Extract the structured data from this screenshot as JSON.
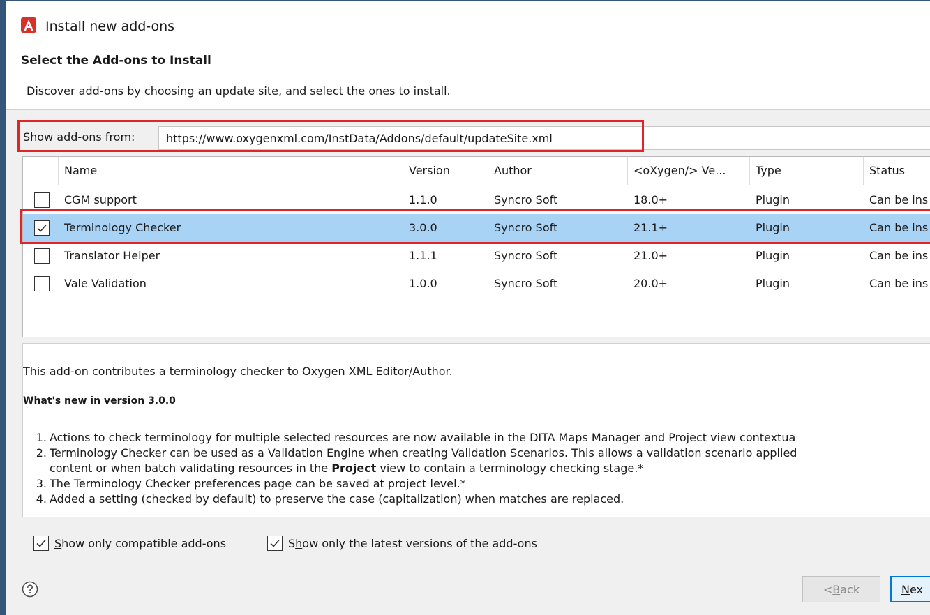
{
  "window": {
    "title": "Install new add-ons"
  },
  "header": {
    "heading": "Select the Add-ons to Install",
    "description": "Discover add-ons by choosing an update site, and select the ones to install."
  },
  "source": {
    "label_pre": "Sh",
    "label_mnemonic": "o",
    "label_post": "w add-ons from:",
    "url": "https://www.oxygenxml.com/InstData/Addons/default/updateSite.xml"
  },
  "table": {
    "columns": [
      "Name",
      "Version",
      "Author",
      "<oXygen/> Ve...",
      "Type",
      "Status"
    ],
    "rows": [
      {
        "checked": false,
        "selected": false,
        "name": "CGM support",
        "version": "1.1.0",
        "author": "Syncro Soft",
        "oxygen": "18.0+",
        "type": "Plugin",
        "status": "Can be ins"
      },
      {
        "checked": true,
        "selected": true,
        "name": "Terminology Checker",
        "version": "3.0.0",
        "author": "Syncro Soft",
        "oxygen": "21.1+",
        "type": "Plugin",
        "status": "Can be ins"
      },
      {
        "checked": false,
        "selected": false,
        "name": "Translator Helper",
        "version": "1.1.1",
        "author": "Syncro Soft",
        "oxygen": "21.0+",
        "type": "Plugin",
        "status": "Can be ins"
      },
      {
        "checked": false,
        "selected": false,
        "name": "Vale Validation",
        "version": "1.0.0",
        "author": "Syncro Soft",
        "oxygen": "20.0+",
        "type": "Plugin",
        "status": "Can be ins"
      }
    ]
  },
  "details": {
    "intro": "This add-on contributes a terminology checker to Oxygen XML Editor/Author.",
    "whats_new": "What's new in version 3.0.0",
    "items": [
      {
        "num": "1.",
        "text": "Actions to check terminology for multiple selected resources are now available in the DITA Maps Manager and Project view contextua"
      },
      {
        "num": "2.",
        "text": "Terminology Checker can be used as a Validation Engine when creating Validation Scenarios. This allows a validation scenario applied"
      },
      {
        "num": "",
        "pre": "content or when batch validating resources in the ",
        "bold": "Project",
        "post": " view to contain a terminology checking stage.*"
      },
      {
        "num": "3.",
        "text": "The Terminology Checker preferences page can be saved at project level.*"
      },
      {
        "num": "4.",
        "text": "Added a setting (checked by default) to preserve the case (capitalization) when matches are replaced."
      }
    ]
  },
  "options": {
    "compatible_mnemonic": "S",
    "compatible_rest": "how only compatible add-ons",
    "compatible_checked": true,
    "latest_pre": "S",
    "latest_mnemonic": "h",
    "latest_rest": "ow only the latest versions of the add-ons",
    "latest_checked": true
  },
  "footer": {
    "back_pre": "< ",
    "back_mnemonic": "B",
    "back_rest": "ack",
    "next_mnemonic": "N",
    "next_rest": "ex"
  },
  "icons": {
    "app": "oxygen-app-icon",
    "help": "help-icon",
    "check": "checkmark-icon"
  },
  "colors": {
    "highlight": "#e0242c",
    "selection": "#a9d3f5",
    "accent": "#0078d7"
  }
}
